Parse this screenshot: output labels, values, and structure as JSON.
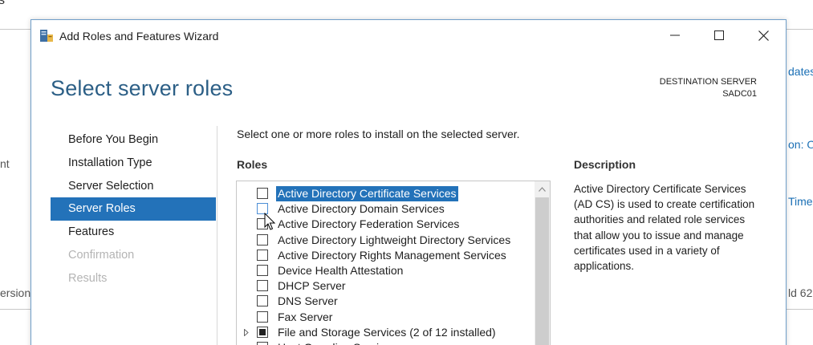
{
  "background": {
    "fragments": [
      "s",
      "nt",
      "ersion",
      "dates",
      "on: Or",
      "Time",
      "ld 62"
    ]
  },
  "window": {
    "title": "Add Roles and Features Wizard",
    "buttons": [
      "minimize",
      "maximize",
      "close"
    ]
  },
  "page": {
    "heading": "Select server roles",
    "destination_label": "DESTINATION SERVER",
    "destination_server": "SADC01"
  },
  "nav": {
    "items": [
      {
        "label": "Before You Begin",
        "state": "normal"
      },
      {
        "label": "Installation Type",
        "state": "normal"
      },
      {
        "label": "Server Selection",
        "state": "normal"
      },
      {
        "label": "Server Roles",
        "state": "active"
      },
      {
        "label": "Features",
        "state": "normal"
      },
      {
        "label": "Confirmation",
        "state": "disabled"
      },
      {
        "label": "Results",
        "state": "disabled"
      }
    ]
  },
  "main": {
    "instruction": "Select one or more roles to install on the selected server.",
    "roles_label": "Roles",
    "description_label": "Description",
    "description_text": "Active Directory Certificate Services (AD CS) is used to create certification authorities and related role services that allow you to issue and manage certificates used in a variety of applications."
  },
  "roles": [
    {
      "label": "Active Directory Certificate Services",
      "checked": false,
      "selected": true
    },
    {
      "label": "Active Directory Domain Services",
      "checked": false,
      "selected": false
    },
    {
      "label": "Active Directory Federation Services",
      "checked": false,
      "selected": false
    },
    {
      "label": "Active Directory Lightweight Directory Services",
      "checked": false,
      "selected": false
    },
    {
      "label": "Active Directory Rights Management Services",
      "checked": false,
      "selected": false
    },
    {
      "label": "Device Health Attestation",
      "checked": false,
      "selected": false
    },
    {
      "label": "DHCP Server",
      "checked": false,
      "selected": false
    },
    {
      "label": "DNS Server",
      "checked": false,
      "selected": false
    },
    {
      "label": "Fax Server",
      "checked": false,
      "selected": false
    },
    {
      "label": "File and Storage Services (2 of 12 installed)",
      "checked": "partial",
      "selected": false,
      "expandable": true
    },
    {
      "label": "Host Guardian Service",
      "checked": false,
      "selected": false
    }
  ],
  "colors": {
    "accent": "#2372b9",
    "heading": "#2c5f86",
    "window_border": "#6f9ec9"
  }
}
